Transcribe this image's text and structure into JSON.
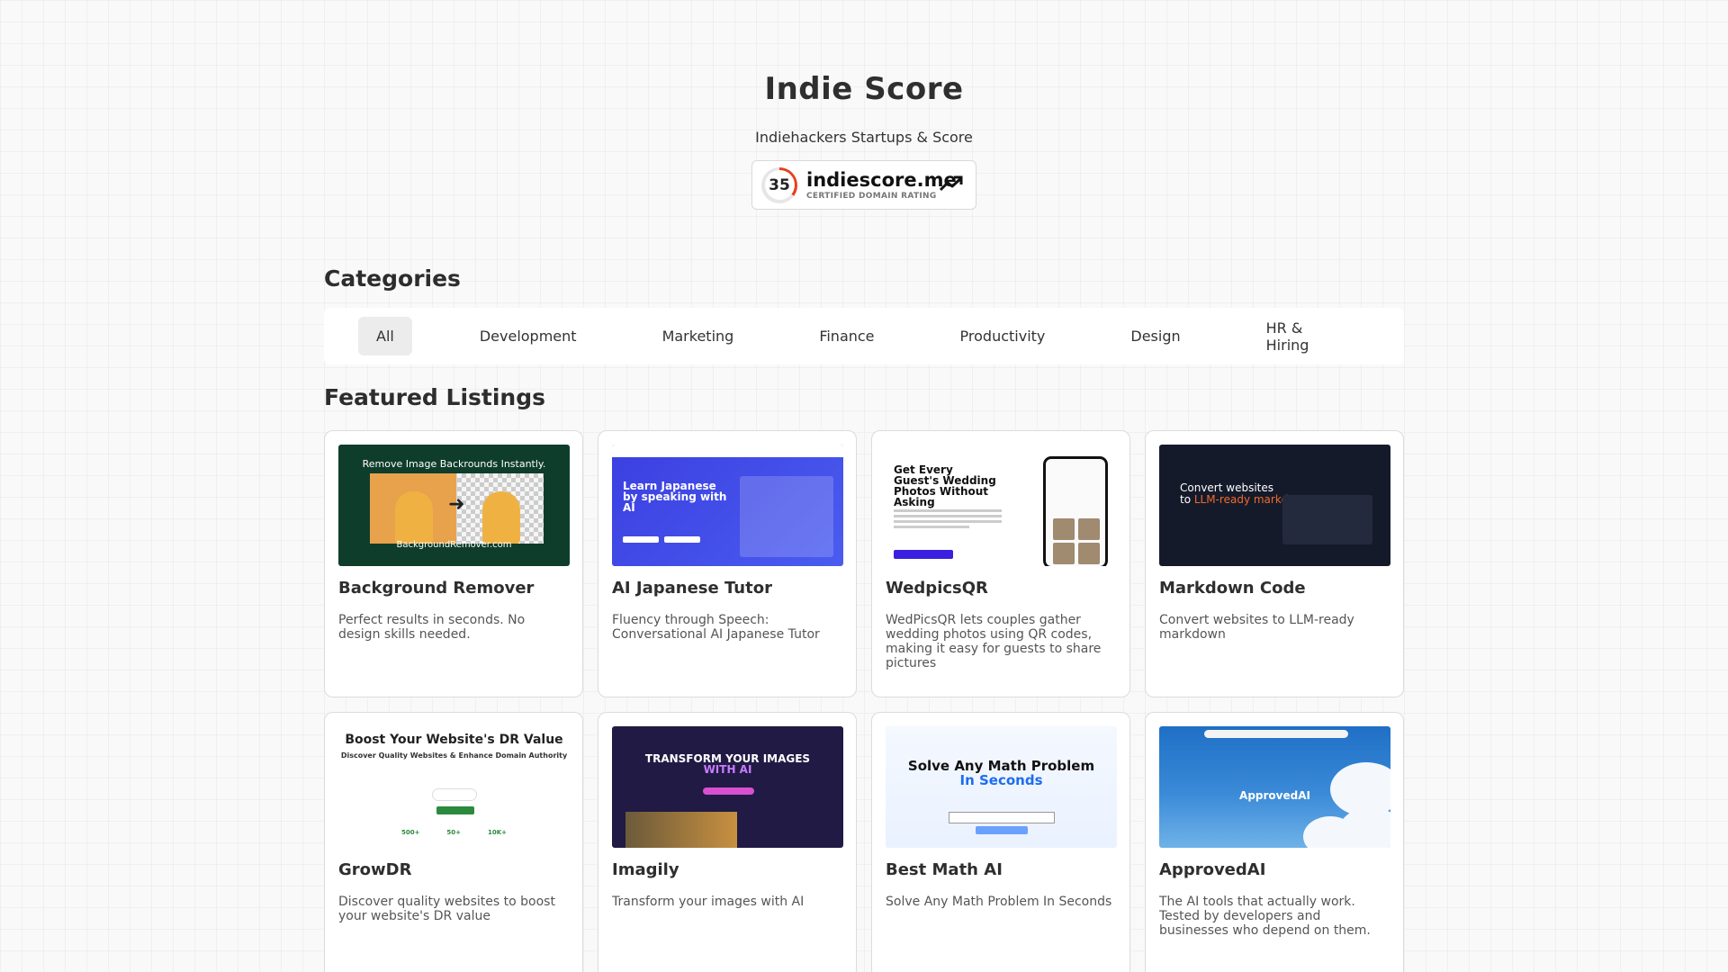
{
  "header": {
    "title": "Indie Score",
    "subtitle": "Indiehackers Startups & Score",
    "badge": {
      "score": "35",
      "domain": "indiescore.me",
      "caption": "CERTIFIED DOMAIN RATING",
      "accent_color": "#e8401c"
    }
  },
  "categories": {
    "title": "Categories",
    "tabs": [
      "All",
      "Development",
      "Marketing",
      "Finance",
      "Productivity",
      "Design",
      "HR & Hiring"
    ],
    "active": "All"
  },
  "featured": {
    "title": "Featured Listings",
    "listings": [
      {
        "name": "Background Remover",
        "description": "Perfect results in seconds. No design skills needed.",
        "thumb_caption": "Remove Image Backrounds Instantly.",
        "thumb_footer": "BackgroundRemover.com"
      },
      {
        "name": "AI Japanese Tutor",
        "description": "Fluency through Speech: Conversational AI Japanese Tutor",
        "thumb_heading": "Learn Japanese by speaking with AI"
      },
      {
        "name": "WedpicsQR",
        "description": "WedPicsQR lets couples gather wedding photos using QR codes, making it easy for guests to share pictures",
        "thumb_heading": "Get Every Guest's Wedding Photos Without Asking"
      },
      {
        "name": "Markdown Code",
        "description": "Convert websites to LLM-ready markdown",
        "thumb_heading_1": "Convert websites",
        "thumb_heading_2": "to",
        "thumb_heading_accent": "LLM-ready markdown"
      },
      {
        "name": "GrowDR",
        "description": "Discover quality websites to boost your website's DR value",
        "thumb_heading": "Boost Your Website's DR Value",
        "thumb_sub": "Discover Quality Websites & Enhance Domain Authority",
        "thumb_stats": [
          "500+",
          "50+",
          "10K+"
        ]
      },
      {
        "name": "Imagily",
        "description": "Transform your images with AI",
        "thumb_heading": "TRANSFORM YOUR IMAGES",
        "thumb_heading_accent": "WITH AI"
      },
      {
        "name": "Best Math AI",
        "description": "Solve Any Math Problem In Seconds",
        "thumb_heading": "Solve Any Math Problem",
        "thumb_heading_accent": "In Seconds"
      },
      {
        "name": "ApprovedAI",
        "description": "The AI tools that actually work. Tested by developers and businesses who depend on them.",
        "thumb_heading": "ApprovedAI"
      }
    ]
  }
}
